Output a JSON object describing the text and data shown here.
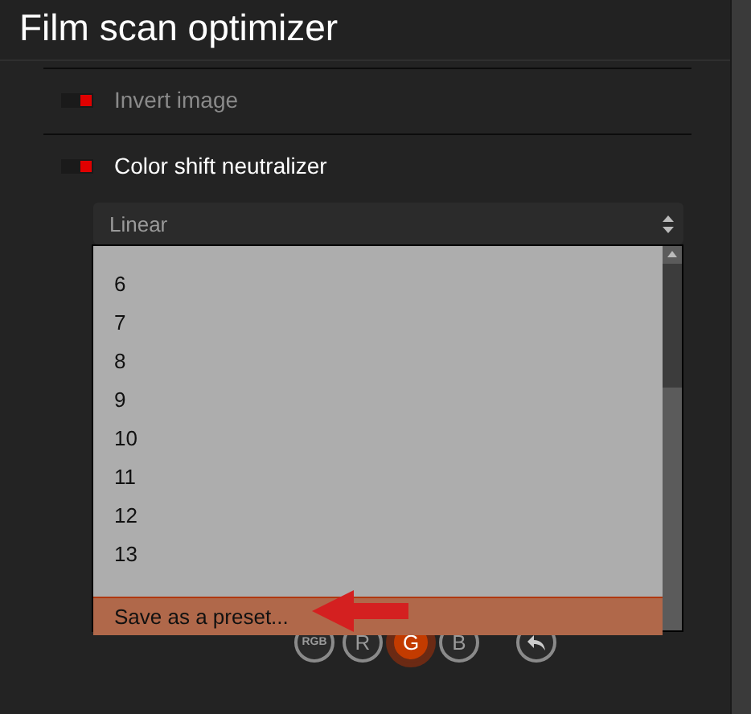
{
  "panel": {
    "title": "Film scan optimizer"
  },
  "toggles": [
    {
      "label": "Invert image",
      "on": true,
      "disabled": true
    },
    {
      "label": "Color shift neutralizer",
      "on": true,
      "disabled": false
    }
  ],
  "mode_select": {
    "value": "Linear"
  },
  "dropdown": {
    "items": [
      "6",
      "7",
      "8",
      "9",
      "10",
      "11",
      "12",
      "13"
    ],
    "action": {
      "label": "Save as a preset...",
      "selected": true
    }
  },
  "channels": [
    {
      "label": "RGB",
      "selected": false
    },
    {
      "label": "R",
      "selected": false
    },
    {
      "label": "G",
      "selected": true
    },
    {
      "label": "B",
      "selected": false
    }
  ]
}
